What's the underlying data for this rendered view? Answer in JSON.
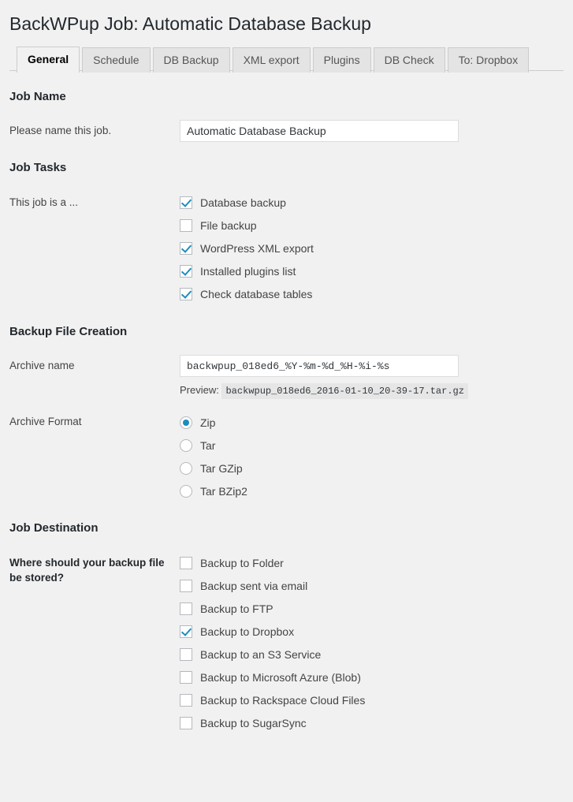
{
  "page": {
    "title": "BackWPup Job: Automatic Database Backup"
  },
  "tabs": [
    {
      "label": "General",
      "active": true
    },
    {
      "label": "Schedule",
      "active": false
    },
    {
      "label": "DB Backup",
      "active": false
    },
    {
      "label": "XML export",
      "active": false
    },
    {
      "label": "Plugins",
      "active": false
    },
    {
      "label": "DB Check",
      "active": false
    },
    {
      "label": "To: Dropbox",
      "active": false
    }
  ],
  "job_name": {
    "section_title": "Job Name",
    "label": "Please name this job.",
    "value": "Automatic Database Backup",
    "placeholder": ""
  },
  "job_tasks": {
    "section_title": "Job Tasks",
    "label": "This job is a ...",
    "options": [
      {
        "label": "Database backup",
        "checked": true
      },
      {
        "label": "File backup",
        "checked": false
      },
      {
        "label": "WordPress XML export",
        "checked": true
      },
      {
        "label": "Installed plugins list",
        "checked": true
      },
      {
        "label": "Check database tables",
        "checked": true
      }
    ]
  },
  "backup_file_creation": {
    "section_title": "Backup File Creation",
    "archive_name_label": "Archive name",
    "archive_name_value": "backwpup_018ed6_%Y-%m-%d_%H-%i-%s",
    "preview_label": "Preview:",
    "preview_value": "backwpup_018ed6_2016-01-10_20-39-17.tar.gz",
    "archive_format_label": "Archive Format",
    "formats": [
      {
        "label": "Zip",
        "selected": true
      },
      {
        "label": "Tar",
        "selected": false
      },
      {
        "label": "Tar GZip",
        "selected": false
      },
      {
        "label": "Tar BZip2",
        "selected": false
      }
    ]
  },
  "job_destination": {
    "section_title": "Job Destination",
    "label": "Where should your backup file be stored?",
    "options": [
      {
        "label": "Backup to Folder",
        "checked": false
      },
      {
        "label": "Backup sent via email",
        "checked": false
      },
      {
        "label": "Backup to FTP",
        "checked": false
      },
      {
        "label": "Backup to Dropbox",
        "checked": true
      },
      {
        "label": "Backup to an S3 Service",
        "checked": false
      },
      {
        "label": "Backup to Microsoft Azure (Blob)",
        "checked": false
      },
      {
        "label": "Backup to Rackspace Cloud Files",
        "checked": false
      },
      {
        "label": "Backup to SugarSync",
        "checked": false
      }
    ]
  },
  "colors": {
    "accent": "#1e8cbe",
    "background": "#f1f1f1",
    "heading": "#23282d",
    "tab_inactive": "#e4e4e4",
    "border": "#cccccc"
  }
}
